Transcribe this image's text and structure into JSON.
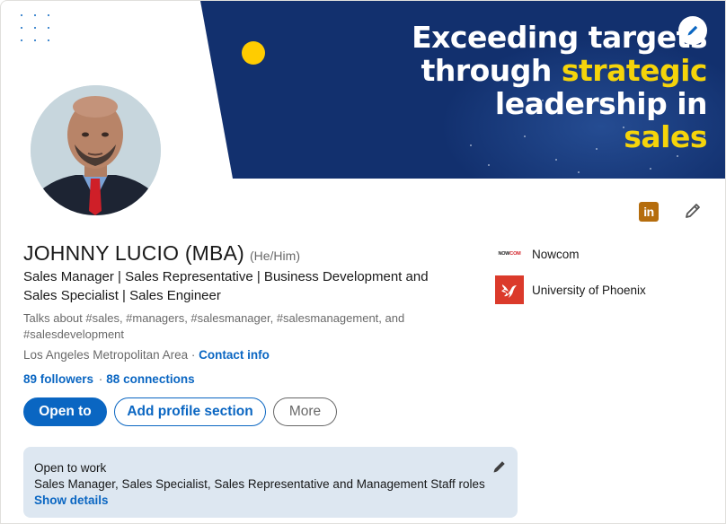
{
  "banner": {
    "line1": "Exceeding targets",
    "line2_plain": "through ",
    "line2_hl": "strategic",
    "line3": "leadership in",
    "line4_hl": "sales"
  },
  "profile": {
    "name": "JOHNNY LUCIO (MBA)",
    "pronouns": "(He/Him)",
    "headline": "Sales Manager | Sales Representative | Business Development and Sales Specialist | Sales Engineer",
    "talks_about": "Talks about #sales, #managers, #salesmanager, #salesmanagement, and #salesdevelopment",
    "location": "Los Angeles Metropolitan Area",
    "location_sep": " · ",
    "contact_info": "Contact info",
    "followers": "89 followers",
    "network_sep": "·",
    "connections": "88 connections"
  },
  "actions": {
    "open_to": "Open to",
    "add_section": "Add profile section",
    "more": "More"
  },
  "experience": [
    {
      "name": "Nowcom",
      "logo_text_a": "NOW",
      "logo_text_b": "COM",
      "icon": "nowcom-logo"
    },
    {
      "name": "University of Phoenix",
      "icon": "phoenix-logo"
    }
  ],
  "badge": {
    "text": "in"
  },
  "open_to_work": {
    "title": "Open to work",
    "roles": "Sales Manager, Sales Specialist, Sales Representative and Management Staff roles",
    "show_details": "Show details"
  },
  "colors": {
    "brand_blue": "#0a66c2",
    "banner_navy": "#12306e",
    "highlight_yellow": "#f5d40a",
    "open_to_work_bg": "#dde7f1",
    "linkedin_badge": "#b56d0d",
    "phoenix_red": "#db3a2b"
  }
}
